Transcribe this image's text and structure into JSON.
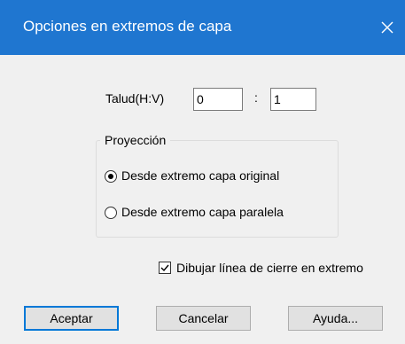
{
  "window": {
    "title": "Opciones en extremos de capa",
    "close_glyph": "✕"
  },
  "slope": {
    "label": "Talud(H:V)",
    "h_value": "0",
    "separator": ":",
    "v_value": "1"
  },
  "projection": {
    "group_label": "Proyección",
    "options": [
      {
        "label": "Desde extremo capa original",
        "selected": true
      },
      {
        "label": "Desde extremo capa paralela",
        "selected": false
      }
    ]
  },
  "closing_line": {
    "label": "Dibujar línea de cierre en extremo",
    "checked": true
  },
  "buttons": {
    "accept": "Aceptar",
    "cancel": "Cancelar",
    "help": "Ayuda..."
  },
  "colors": {
    "titlebar": "#1f76d0",
    "dialog_bg": "#f0f0f0",
    "focus_border": "#0078d7"
  }
}
